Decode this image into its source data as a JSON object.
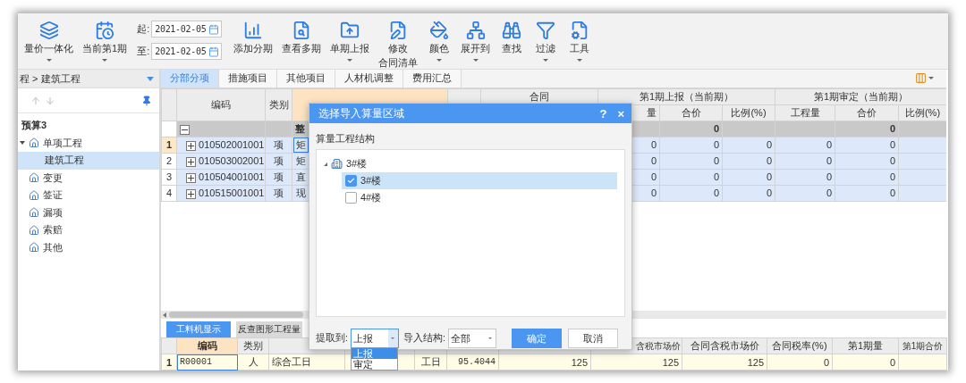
{
  "toolbar": {
    "items": [
      {
        "kind": "button",
        "label": "量价一体化",
        "caret": true
      },
      {
        "kind": "button",
        "label": "当前第1期",
        "caret": true
      },
      {
        "kind": "dates",
        "fields": [
          {
            "label": "起:",
            "value": "2021-02-05"
          },
          {
            "label": "至:",
            "value": "2021-02-05"
          }
        ]
      },
      {
        "kind": "button",
        "label": "添加分期",
        "caret": false
      },
      {
        "kind": "button",
        "label": "查看多期",
        "caret": false
      },
      {
        "kind": "button",
        "label": "单期上报",
        "caret": true
      },
      {
        "kind": "button",
        "lines": [
          "修改",
          "合同清单"
        ],
        "caret": false
      },
      {
        "kind": "button",
        "label": "颜色",
        "caret": true
      },
      {
        "kind": "button",
        "label": "展开到",
        "caret": true
      },
      {
        "kind": "button",
        "label": "查找",
        "caret": false
      },
      {
        "kind": "button",
        "label": "过滤",
        "caret": true
      },
      {
        "kind": "button",
        "label": "工具",
        "caret": true
      }
    ]
  },
  "sidebar": {
    "breadcrumb": "程 > 建筑工程",
    "tree": [
      {
        "label": "预算3",
        "selected": false,
        "children": [
          {
            "label": "单项工程",
            "selected": false,
            "expanded": true,
            "children": [
              {
                "label": "建筑工程",
                "selected": true
              }
            ]
          },
          {
            "label": "变更",
            "selected": false,
            "expanded": false
          },
          {
            "label": "签证",
            "selected": false,
            "expanded": false
          },
          {
            "label": "漏项",
            "selected": false,
            "expanded": false
          },
          {
            "label": "索赔",
            "selected": false,
            "expanded": false
          },
          {
            "label": "其他",
            "selected": false,
            "expanded": false
          }
        ]
      }
    ]
  },
  "tabs": [
    {
      "label": "分部分项",
      "selected": true
    },
    {
      "label": "措施项目",
      "selected": false
    },
    {
      "label": "其他项目",
      "selected": false
    },
    {
      "label": "人材机调整",
      "selected": false
    },
    {
      "label": "费用汇总",
      "selected": false
    }
  ],
  "table": {
    "columns": [
      {
        "label": "编码"
      },
      {
        "label": "类别"
      }
    ],
    "name_column": {
      "highlighted": true
    },
    "groups": [
      {
        "label": "合同"
      },
      {
        "label": "第1期上报（当前期）",
        "columns": [
          "量",
          "合价",
          "比例(%)"
        ]
      },
      {
        "label": "第1期审定（当前期）",
        "columns": [
          "工程量",
          "合价",
          "比例(%)"
        ]
      }
    ],
    "rows": [
      {
        "kind": "group",
        "expanded": true,
        "name": "整",
        "amounts": [
          "0",
          "0"
        ]
      },
      {
        "kind": "item",
        "number": "1",
        "selected": true,
        "expanded": false,
        "code": "010502001001",
        "type": "项",
        "name": "矩",
        "values": [
          "0",
          "0",
          "0",
          "0",
          "0"
        ]
      },
      {
        "kind": "item",
        "number": "2",
        "selected": false,
        "expanded": false,
        "code": "010503002001",
        "type": "项",
        "name": "矩",
        "values": [
          "0",
          "0",
          "0",
          "0",
          "0"
        ]
      },
      {
        "kind": "item",
        "number": "3",
        "selected": false,
        "expanded": false,
        "code": "010504001001",
        "type": "项",
        "name": "直",
        "values": [
          "0",
          "0",
          "0",
          "0",
          "0"
        ]
      },
      {
        "kind": "item",
        "number": "4",
        "selected": false,
        "expanded": false,
        "code": "010515001001",
        "type": "项",
        "name": "现",
        "values": [
          "0",
          "0",
          "0",
          "0",
          "0"
        ]
      }
    ]
  },
  "bottom_tabs": [
    {
      "label": "工料机显示",
      "selected": true
    },
    {
      "label": "反查图形工程量",
      "selected": false
    }
  ],
  "bottom_table": {
    "columns": [
      {
        "label": "编码",
        "highlighted": true
      },
      {
        "label": "类别",
        "highlighted": false
      },
      {
        "highlighted": false
      },
      {
        "highlighted": false
      },
      {
        "highlighted": false
      },
      {
        "highlighted": false
      },
      {
        "highlighted": false
      },
      {
        "label": "含税市场价",
        "highlighted": false
      },
      {
        "label": "合同含税市场价",
        "highlighted": false
      },
      {
        "label": "合同税率(%)",
        "highlighted": false
      },
      {
        "label": "第1期量",
        "highlighted": false
      },
      {
        "label": "第1期合价",
        "highlighted": false
      }
    ],
    "rows": [
      {
        "number": "1",
        "selected": true,
        "cells": [
          "R00001",
          "人",
          "综合工日",
          "",
          "工日",
          "95.4044",
          "125",
          "125",
          "125",
          "0",
          "0",
          ""
        ]
      }
    ]
  },
  "dialog": {
    "title": "选择导入算量区域",
    "help": "?",
    "close": "×",
    "section_label": "算量工程结构",
    "tree": [
      {
        "label": "3#楼",
        "expanded": true,
        "children": [
          {
            "label": "3#楼",
            "checked": true,
            "selected": true
          },
          {
            "label": "4#楼",
            "checked": false,
            "selected": false
          }
        ]
      }
    ],
    "fields": [
      {
        "label": "提取到:",
        "value": "上报",
        "open": true,
        "options": [
          {
            "label": "上报",
            "selected": true
          },
          {
            "label": "审定",
            "selected": false
          }
        ]
      },
      {
        "label": "导入结构:",
        "value": "全部",
        "open": false
      }
    ],
    "buttons": [
      {
        "label": "确定",
        "kind": "primary"
      },
      {
        "label": "取消",
        "kind": "secondary"
      }
    ]
  }
}
